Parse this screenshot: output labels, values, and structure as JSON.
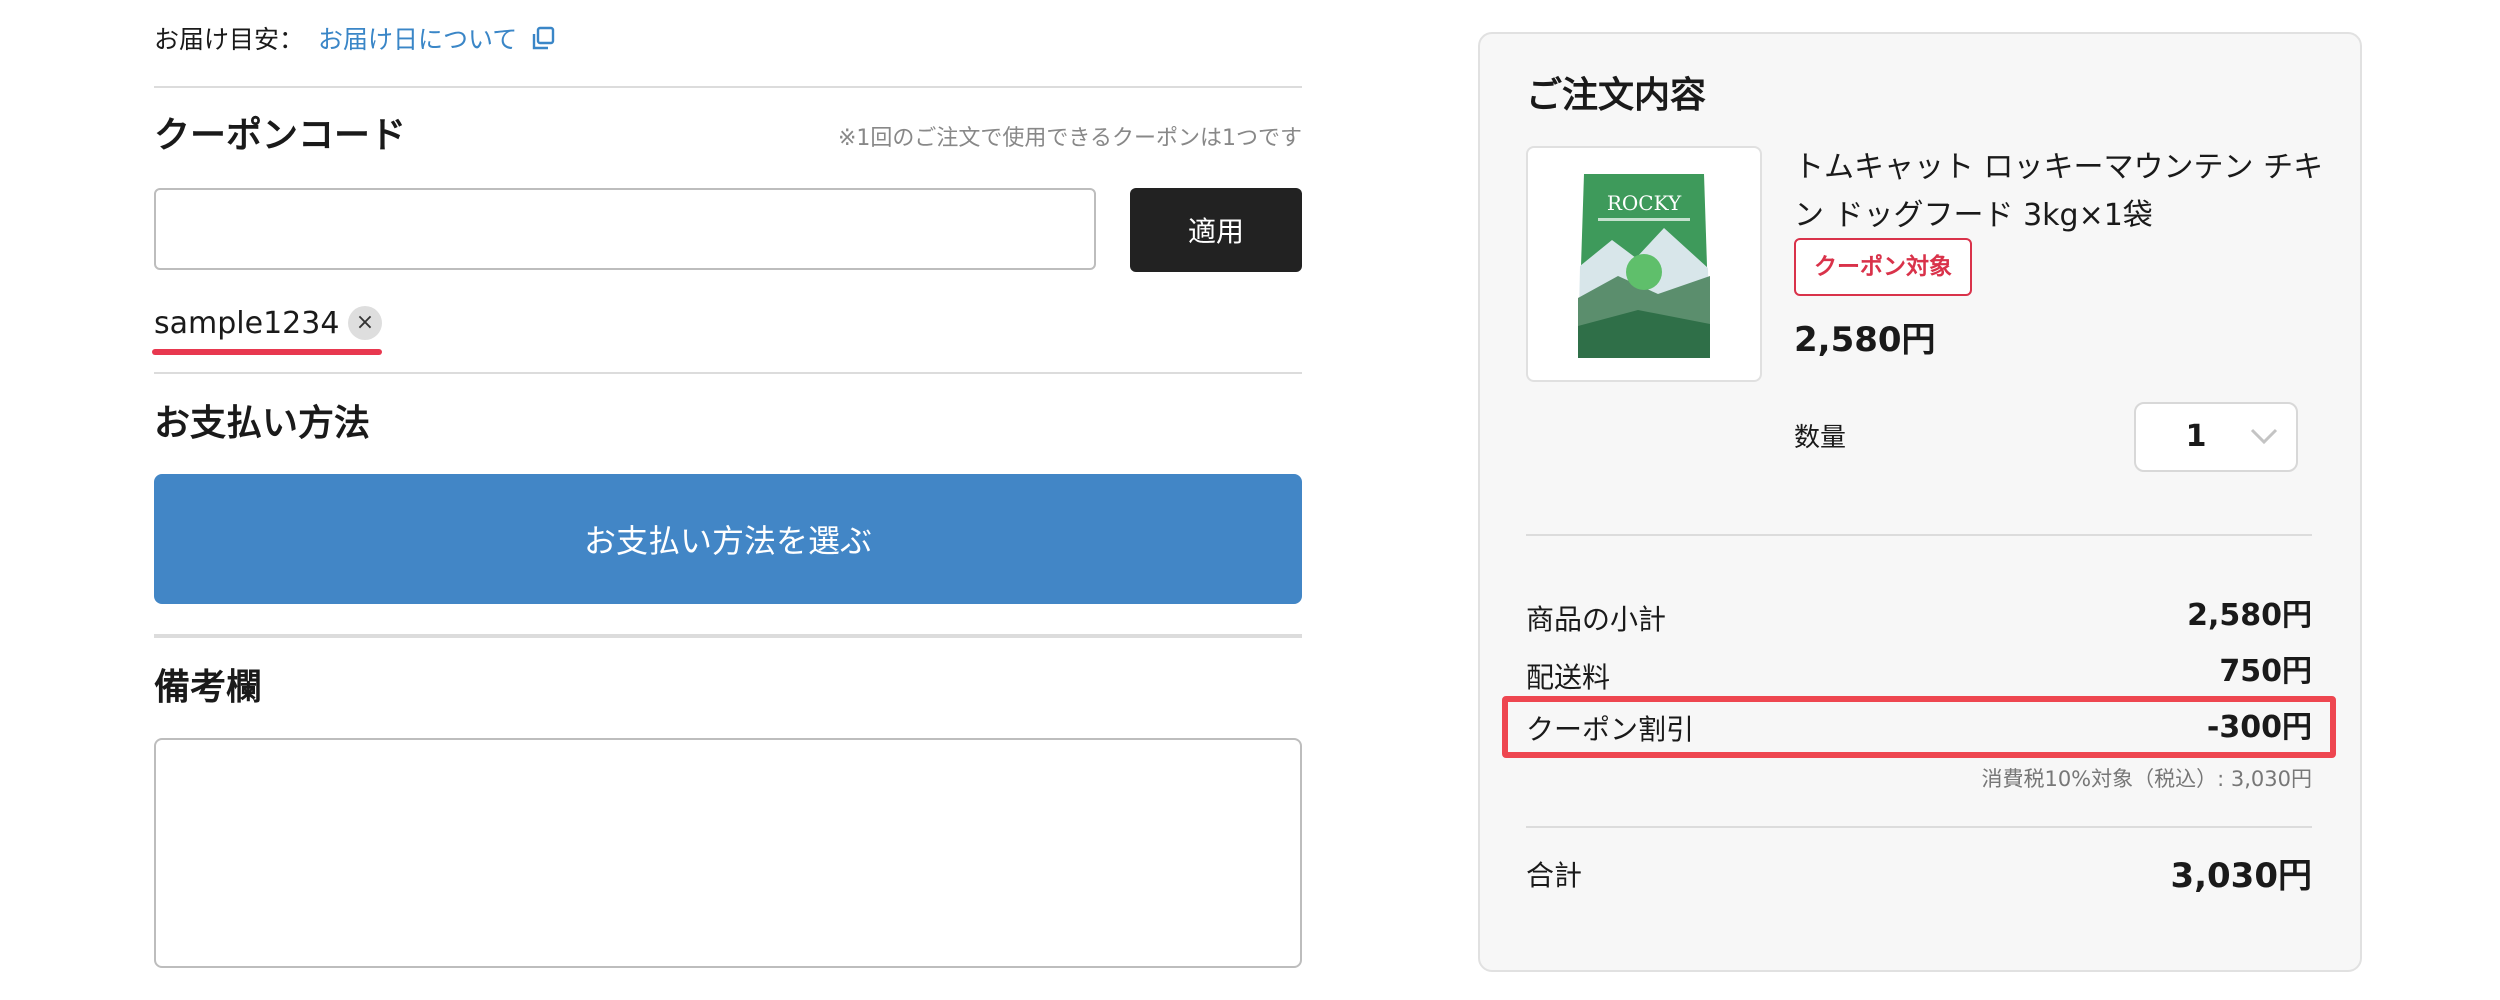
{
  "delivery": {
    "label": "お届け目安：",
    "link_text": "お届け日について"
  },
  "coupon": {
    "title": "クーポンコード",
    "note": "※1回のご注文で使用できるクーポンは1つです",
    "input_value": "",
    "apply_label": "適用",
    "applied_code": "sample1234",
    "remove_glyph": "×"
  },
  "payment": {
    "title": "お支払い方法",
    "button_label": "お支払い方法を選ぶ"
  },
  "memo": {
    "title": "備考欄",
    "value": ""
  },
  "order": {
    "title": "ご注文内容",
    "product": {
      "name": "トムキャット ロッキーマウンテン チキン ドッグフード 3kg×1袋",
      "badge": "クーポン対象",
      "price": "2,580円",
      "package_brand": "ROCKY",
      "quantity_label": "数量",
      "quantity": "1"
    },
    "summary": {
      "subtotal_label": "商品の小計",
      "subtotal_value": "2,580円",
      "shipping_label": "配送料",
      "shipping_value": "750円",
      "discount_label": "クーポン割引",
      "discount_value": "-300円",
      "tax_note": "消費税10%対象（税込）: 3,030円",
      "total_label": "合計",
      "total_value": "3,030円"
    }
  },
  "colors": {
    "accent_link": "#3a86c7",
    "pay_button": "#4286c6",
    "apply_button": "#222222",
    "highlight_red": "#ee4650",
    "badge_red": "#d9324a"
  },
  "icons": [
    "copy-icon",
    "close-icon",
    "chevron-down-icon"
  ]
}
